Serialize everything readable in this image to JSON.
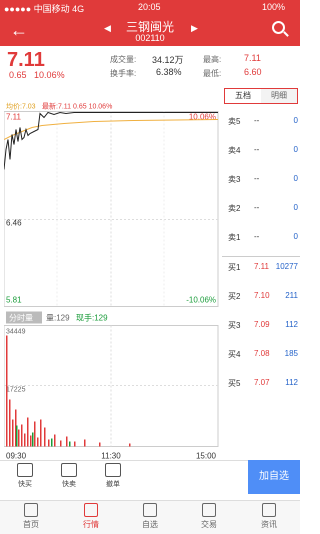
{
  "status": {
    "carrier": "●●●●● 中国移动  4G",
    "time": "20:05",
    "battery": "100%"
  },
  "nav": {
    "title": "三钢闽光",
    "code": "002110",
    "prev": "◀",
    "next": "▶"
  },
  "quote": {
    "price": "7.11",
    "change": "0.65",
    "change_pct": "10.06%",
    "labels": {
      "volume": "成交量:",
      "turnover": "换手率:",
      "high": "最高:",
      "low": "最低:"
    },
    "volume": "34.12万",
    "turnover": "6.38%",
    "high": "7.11",
    "low": "6.60"
  },
  "chart_header": {
    "avg": "均价:7.03",
    "latest": "最新:7.11 0.65 10.06%"
  },
  "chart_data": {
    "type": "line",
    "price_axis": {
      "max": "7.11",
      "mid": "6.46",
      "min": "5.81",
      "max_pct": "10.06%",
      "min_pct": "-10.06%"
    },
    "x_ticks": [
      "09:30",
      "11:30",
      "15:00"
    ],
    "volume_axis": {
      "max": "34449",
      "mid": "17225"
    },
    "series": [
      {
        "values": [
          7.11,
          7.11,
          7.11,
          7.11,
          7.11,
          7.11,
          7.11,
          7.11,
          7.11,
          7.11
        ]
      }
    ]
  },
  "volume_bar": {
    "tab": "分时量",
    "qty_label": "量:129",
    "now_label": "现手:129"
  },
  "tabs": {
    "five": "五档",
    "detail": "明细"
  },
  "asks": [
    {
      "label": "卖5",
      "price": "--",
      "vol": "0"
    },
    {
      "label": "卖4",
      "price": "--",
      "vol": "0"
    },
    {
      "label": "卖3",
      "price": "--",
      "vol": "0"
    },
    {
      "label": "卖2",
      "price": "--",
      "vol": "0"
    },
    {
      "label": "卖1",
      "price": "--",
      "vol": "0"
    }
  ],
  "bids": [
    {
      "label": "买1",
      "price": "7.11",
      "vol": "10277"
    },
    {
      "label": "买2",
      "price": "7.10",
      "vol": "211"
    },
    {
      "label": "买3",
      "price": "7.09",
      "vol": "112"
    },
    {
      "label": "买4",
      "price": "7.08",
      "vol": "185"
    },
    {
      "label": "买5",
      "price": "7.07",
      "vol": "112"
    }
  ],
  "toolbar": {
    "buy": "快买",
    "sell": "快卖",
    "cancel": "撤单",
    "add": "加自选"
  },
  "tabbar": {
    "home": "首页",
    "market": "行情",
    "watch": "自选",
    "trade": "交易",
    "info": "资讯"
  }
}
